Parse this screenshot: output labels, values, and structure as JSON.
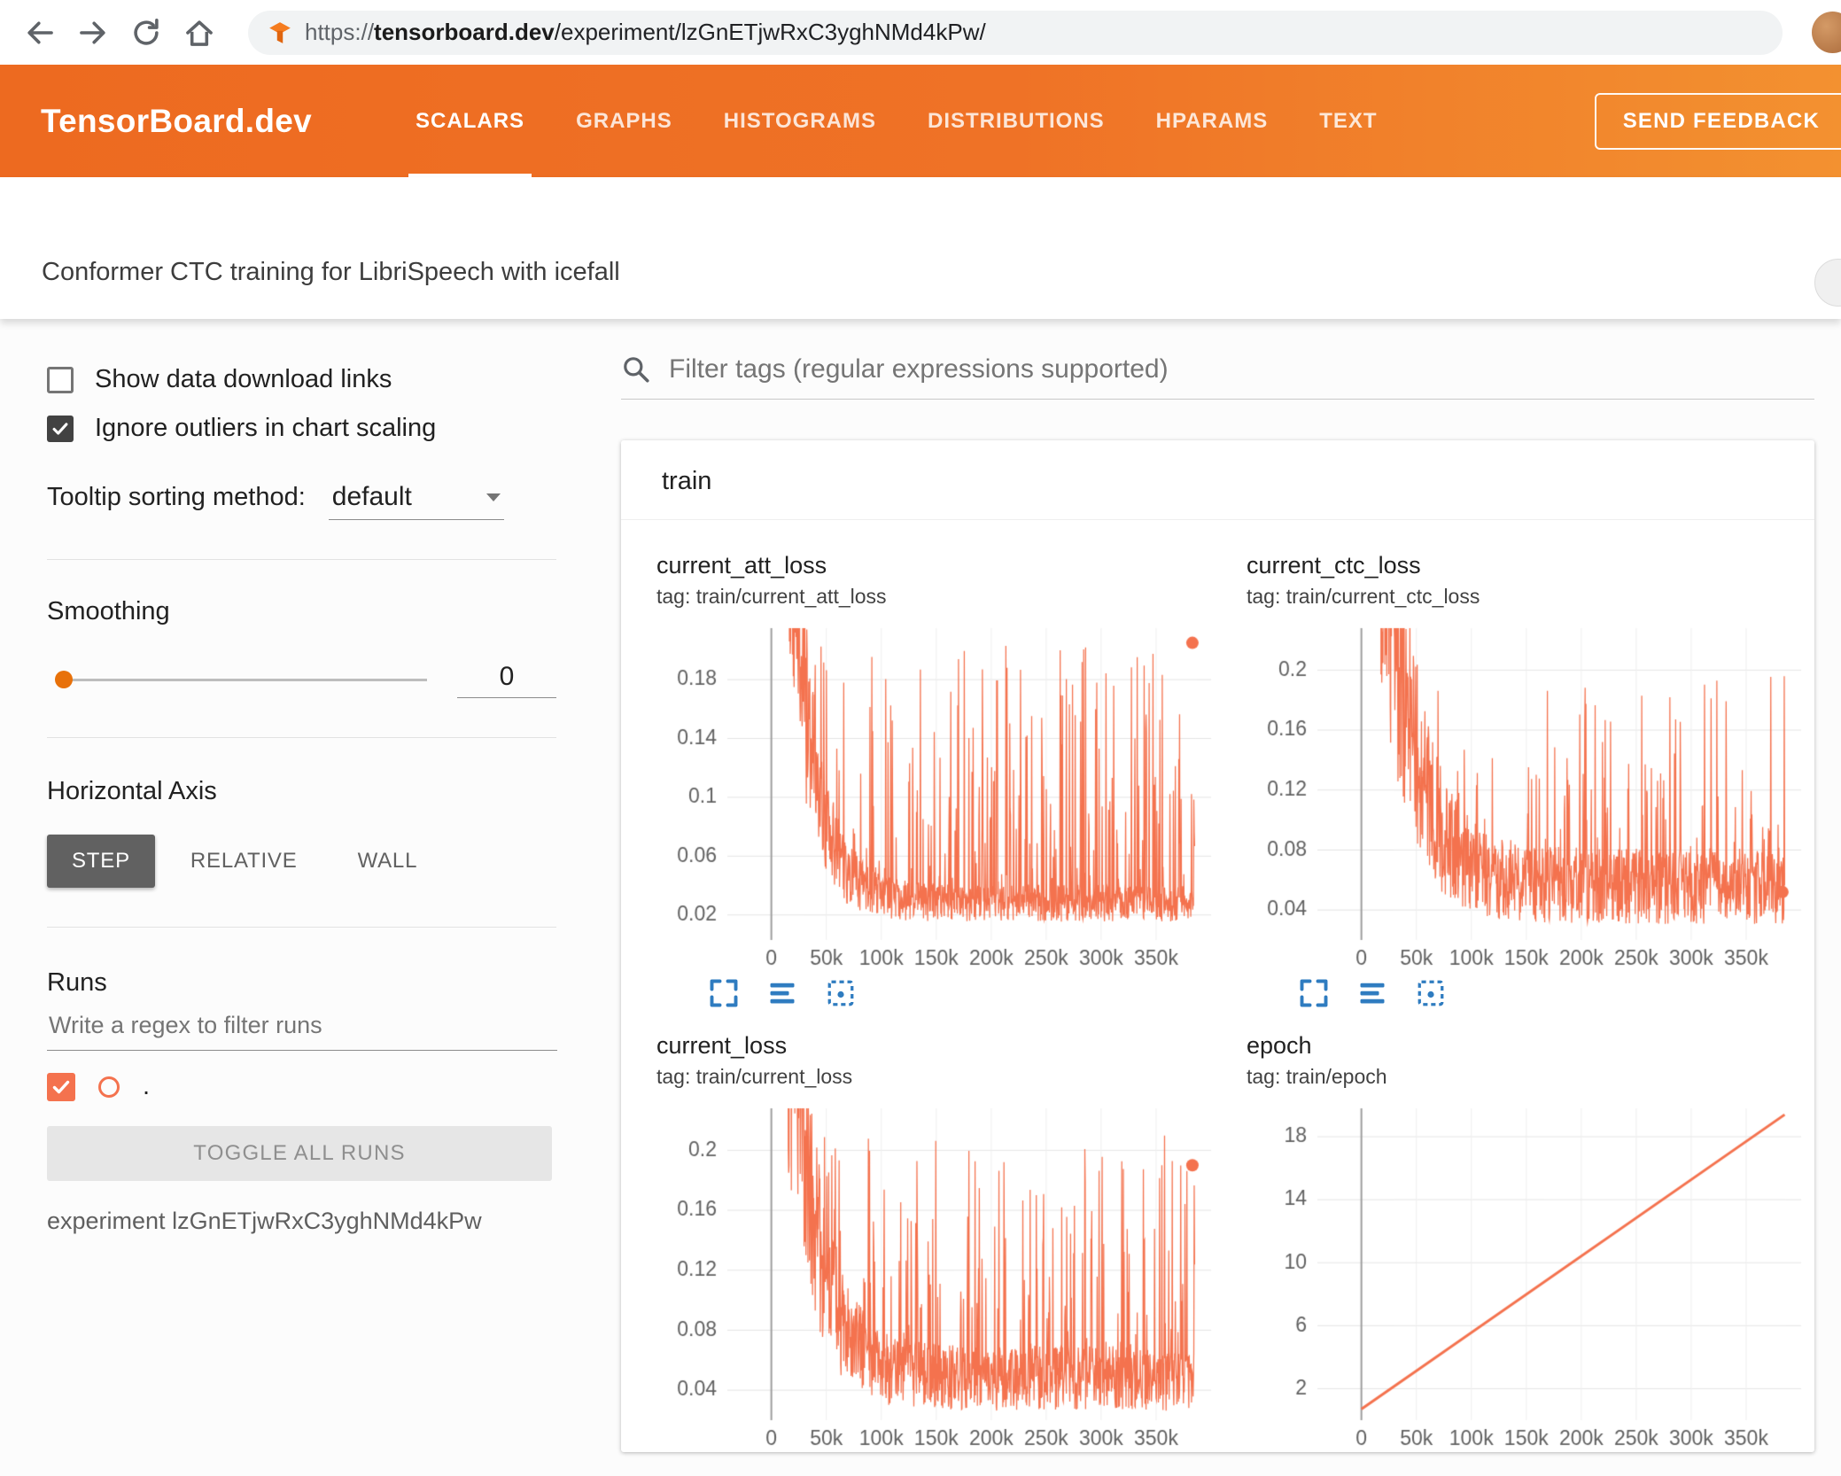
{
  "colors": {
    "accent_orange": "#e8710a",
    "header_orange": "#ee6e24",
    "series_orange": "#f4724e",
    "toolbar_blue": "#2f7cc0"
  },
  "browser": {
    "url_scheme": "https://",
    "url_domain": "tensorboard.dev",
    "url_path": "/experiment/lzGnETjwRxC3yghNMd4kPw/"
  },
  "header": {
    "brand": "TensorBoard.dev",
    "tabs": [
      {
        "label": "SCALARS",
        "active": true
      },
      {
        "label": "GRAPHS",
        "active": false
      },
      {
        "label": "HISTOGRAMS",
        "active": false
      },
      {
        "label": "DISTRIBUTIONS",
        "active": false
      },
      {
        "label": "HPARAMS",
        "active": false
      },
      {
        "label": "TEXT",
        "active": false
      }
    ],
    "feedback_button": "SEND FEEDBACK"
  },
  "experiment_title": "Conformer CTC training for LibriSpeech with icefall",
  "sidebar": {
    "show_download_label": "Show data download links",
    "ignore_outliers_label": "Ignore outliers in chart scaling",
    "tooltip_label": "Tooltip sorting method:",
    "tooltip_value": "default",
    "smoothing_label": "Smoothing",
    "smoothing_value": "0",
    "axis_label": "Horizontal Axis",
    "axis_options": [
      "STEP",
      "RELATIVE",
      "WALL"
    ],
    "axis_selected": "STEP",
    "runs_label": "Runs",
    "runs_placeholder": "Write a regex to filter runs",
    "run_name": ".",
    "toggle_runs_label": "TOGGLE ALL RUNS",
    "experiment_id_label": "experiment lzGnETjwRxC3yghNMd4kPw"
  },
  "main": {
    "filter_placeholder": "Filter tags (regular expressions supported)",
    "group_label": "train"
  },
  "chart_data": [
    {
      "type": "line",
      "title": "current_att_loss",
      "tag": "tag: train/current_att_loss",
      "xlabel": "step",
      "x_tick_labels": [
        "0",
        "50k",
        "100k",
        "150k",
        "200k",
        "250k",
        "300k",
        "350k"
      ],
      "x_tick_values": [
        0,
        50000,
        100000,
        150000,
        200000,
        250000,
        300000,
        350000
      ],
      "x_range": [
        -40000,
        400000
      ],
      "y_tick_labels": [
        "0.02",
        "0.06",
        "0.1",
        "0.14",
        "0.18"
      ],
      "y_tick_values": [
        0.02,
        0.06,
        0.1,
        0.14,
        0.18
      ],
      "y_range": [
        0.003,
        0.215
      ],
      "series": {
        "shape": "noisy-decay",
        "start": 0.6,
        "floor": 0.028,
        "decay": 18,
        "spike_max": 0.205,
        "spike_prob": 0.22,
        "x_max": 385000,
        "seed": 7
      },
      "end_marker": {
        "x": 383000,
        "y": 0.205
      },
      "color": "#f4724e",
      "grid": true,
      "legend": "none"
    },
    {
      "type": "line",
      "title": "current_ctc_loss",
      "tag": "tag: train/current_ctc_loss",
      "xlabel": "step",
      "x_tick_labels": [
        "0",
        "50k",
        "100k",
        "150k",
        "200k",
        "250k",
        "300k",
        "350k"
      ],
      "x_tick_values": [
        0,
        50000,
        100000,
        150000,
        200000,
        250000,
        300000,
        350000
      ],
      "x_range": [
        -40000,
        400000
      ],
      "y_tick_labels": [
        "0.04",
        "0.08",
        "0.12",
        "0.16",
        "0.2"
      ],
      "y_tick_values": [
        0.04,
        0.08,
        0.12,
        0.16,
        0.2
      ],
      "y_range": [
        0.02,
        0.228
      ],
      "series": {
        "shape": "noisy-decay",
        "start": 0.6,
        "floor": 0.056,
        "decay": 14,
        "spike_max": 0.2,
        "spike_prob": 0.18,
        "x_max": 385000,
        "seed": 13
      },
      "end_marker": {
        "x": 383000,
        "y": 0.052
      },
      "color": "#f4724e",
      "grid": true,
      "legend": "none"
    },
    {
      "type": "line",
      "title": "current_loss",
      "tag": "tag: train/current_loss",
      "xlabel": "step",
      "x_tick_labels": [
        "0",
        "50k",
        "100k",
        "150k",
        "200k",
        "250k",
        "300k",
        "350k"
      ],
      "x_tick_values": [
        0,
        50000,
        100000,
        150000,
        200000,
        250000,
        300000,
        350000
      ],
      "x_range": [
        -40000,
        400000
      ],
      "y_tick_labels": [
        "0.04",
        "0.08",
        "0.12",
        "0.16",
        "0.2"
      ],
      "y_tick_values": [
        0.04,
        0.08,
        0.12,
        0.16,
        0.2
      ],
      "y_range": [
        0.02,
        0.228
      ],
      "series": {
        "shape": "noisy-decay",
        "start": 0.6,
        "floor": 0.048,
        "decay": 16,
        "spike_max": 0.21,
        "spike_prob": 0.2,
        "x_max": 385000,
        "seed": 21
      },
      "end_marker": {
        "x": 383000,
        "y": 0.19
      },
      "color": "#f4724e",
      "grid": true,
      "legend": "none"
    },
    {
      "type": "line",
      "title": "epoch",
      "tag": "tag: train/epoch",
      "xlabel": "step",
      "x_tick_labels": [
        "0",
        "50k",
        "100k",
        "150k",
        "200k",
        "250k",
        "300k",
        "350k"
      ],
      "x_tick_values": [
        0,
        50000,
        100000,
        150000,
        200000,
        250000,
        300000,
        350000
      ],
      "x_range": [
        -40000,
        400000
      ],
      "y_tick_labels": [
        "2",
        "6",
        "10",
        "14",
        "18"
      ],
      "y_tick_values": [
        2,
        6,
        10,
        14,
        18
      ],
      "y_range": [
        0,
        19.8
      ],
      "series": {
        "shape": "linear",
        "x0": 0,
        "y0": 0.7,
        "x1": 385000,
        "y1": 19.4,
        "seed": 0
      },
      "color": "#f4724e",
      "grid": true,
      "legend": "none"
    }
  ]
}
